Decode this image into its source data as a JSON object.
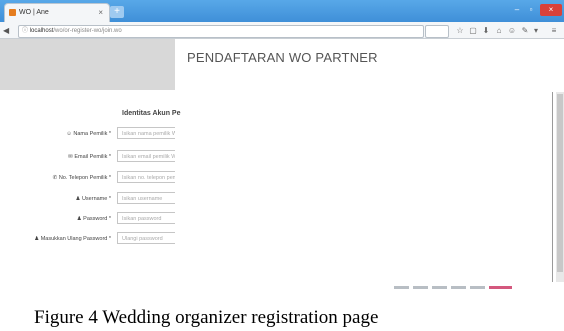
{
  "browser": {
    "tab_title": "WO | Ane",
    "tab_close": "×",
    "new_tab": "+",
    "url_host": "localhost",
    "url_path": "/wo/or-register-wo/join.wo",
    "min_glyph": "–",
    "max_glyph": "▫",
    "close_glyph": "×",
    "toolbar_icons": [
      "☆",
      "▢",
      "⬇",
      "⌂",
      "☺",
      "✎",
      "▾",
      "≡"
    ]
  },
  "page": {
    "header_title": "PENDAFTARAN WO PARTNER",
    "section_title": "Identitas Akun Pe",
    "fields": [
      {
        "label": "Nama Pemilik *",
        "icon": "☺",
        "placeholder": "Isikan nama pemilik W"
      },
      {
        "label": "Email Pemilik *",
        "icon": "✉",
        "placeholder": "Isikan email pemilik W"
      },
      {
        "label": "No. Telepon Pemilik *",
        "icon": "✆",
        "placeholder": "Isikan no. telepon pem"
      },
      {
        "label": "Username *",
        "icon": "♟",
        "placeholder": "Isikan username"
      },
      {
        "label": "Password *",
        "icon": "♟",
        "placeholder": "Isikan password"
      },
      {
        "label": "Masukkan Ulang Password *",
        "icon": "♟",
        "placeholder": "Ulangi password"
      }
    ]
  },
  "progress": {
    "steps": 6,
    "current_step": 6,
    "active_color": "#d4587e",
    "inactive_color": "#b8bec4"
  },
  "caption": "Figure 4 Wedding organizer registration page"
}
